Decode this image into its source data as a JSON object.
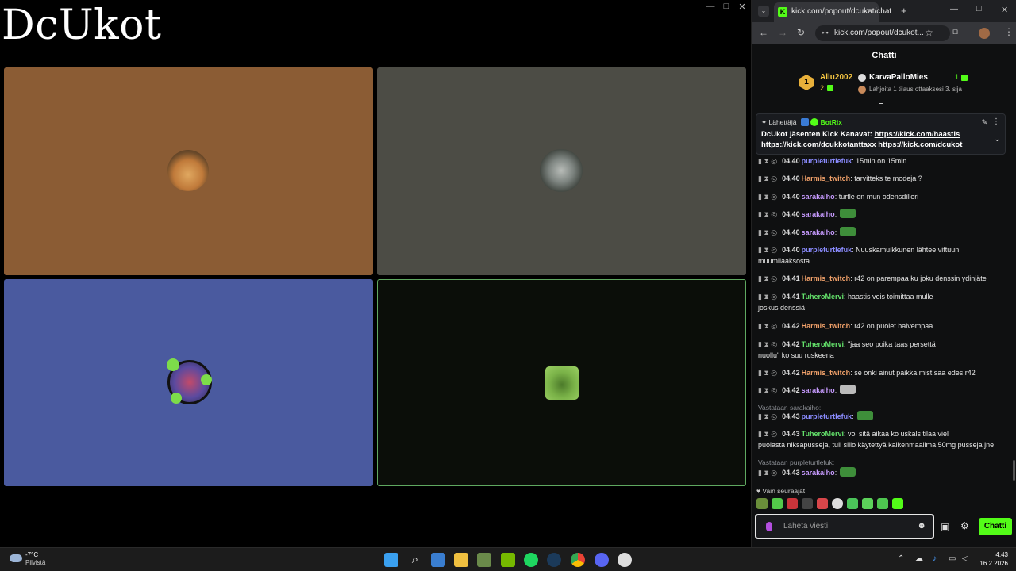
{
  "stream": {
    "title": "DcUkot",
    "window_controls": [
      "—",
      "□",
      "✕"
    ],
    "tiles": [
      {
        "color": "#8b5c34"
      },
      {
        "color": "#4c4c45"
      },
      {
        "color": "#4a5a9f"
      },
      {
        "color": "#0b0e09",
        "border": "#5fa860"
      }
    ]
  },
  "browser": {
    "tab_title": "kick.com/popout/dcukot/chat",
    "tab_close": "×",
    "new_tab": "+",
    "window_controls": [
      "—",
      "□",
      "✕"
    ],
    "url": "kick.com/popout/dcukot...",
    "nav": {
      "back": "←",
      "forward": "→",
      "reload": "↻"
    },
    "toolbar_icons": [
      "star-icon",
      "extensions-icon",
      "profile-icon",
      "menu-icon"
    ]
  },
  "chat": {
    "header": "Chatti",
    "podium": {
      "rank": "1",
      "first_name": "Allu2002",
      "first_count": "2",
      "second_name": "KarvaPalloMies",
      "second_count": "1",
      "hint": "Lahjoita 1 tilaus ottaaksesi 3. sija"
    },
    "pinned": {
      "prefix": "Lähettäjä",
      "bot": "BotRix",
      "text": "DcUkot jäsenten Kick Kanavat:",
      "link1": "https://kick.com/haastis",
      "link2": "https://kick.com/dcukkotanttaxx",
      "link3": "https://kick.com/dcukot"
    },
    "messages": [
      {
        "time": "04.40",
        "user": "purpleturtlefuk",
        "color": "#8b8cff",
        "text": ": 15min on 15min"
      },
      {
        "time": "04.40",
        "user": "Harmis_twitch",
        "color": "#f1a16a",
        "text": ": tarvitteks te modeja ?"
      },
      {
        "time": "04.40",
        "user": "sarakaiho",
        "color": "#c79bff",
        "text": ": turtle on mun odensdilleri"
      },
      {
        "time": "04.40",
        "user": "sarakaiho",
        "color": "#c79bff",
        "text": ":"
      },
      {
        "time": "04.40",
        "user": "sarakaiho",
        "color": "#c79bff",
        "text": ":"
      },
      {
        "time": "04.40",
        "user": "purpleturtlefuk",
        "color": "#8b8cff",
        "text": ": Nuuskamuikkunen lähtee vittuun",
        "text2": "muumilaaksosta"
      },
      {
        "time": "04.41",
        "user": "Harmis_twitch",
        "color": "#f1a16a",
        "text": ": r42 on parempaa ku joku denssin ydinjäte"
      },
      {
        "time": "04.41",
        "user": "TuheroMervi",
        "color": "#63e06a",
        "text": ": haastis vois toimittaa mulle",
        "text2": "joskus denssiä"
      },
      {
        "time": "04.42",
        "user": "Harmis_twitch",
        "color": "#f1a16a",
        "text": ": r42 on puolet halvempaa"
      },
      {
        "time": "04.42",
        "user": "TuheroMervi",
        "color": "#63e06a",
        "text": ": \"jaa seo poika taas persettä",
        "text2": "nuollu\" ko suu ruskeena"
      },
      {
        "time": "04.42",
        "user": "Harmis_twitch",
        "color": "#f1a16a",
        "text": ": se onki ainut paikka mist saa edes r42"
      },
      {
        "time": "04.42",
        "user": "sarakaiho",
        "color": "#c79bff",
        "text": ":"
      },
      {
        "time": "04.43",
        "user": "purpleturtlefuk",
        "color": "#8b8cff",
        "text": ":"
      },
      {
        "time": "04.43",
        "user": "TuheroMervi",
        "color": "#63e06a",
        "text": ": voi sitä aikaa ko uskals tilaa viel",
        "text2": "puolasta niksapusseja, tuli sillo käytettyä kaikenmaailma 50mg pusseja jne"
      },
      {
        "time": "04.43",
        "user": "sarakaiho",
        "color": "#c79bff",
        "text": ":"
      }
    ],
    "replies": [
      "Vastataan sarakaiho:",
      "Vastataan purpleturtlefuk:"
    ],
    "followers_only": "Vain seuraajat",
    "input_placeholder": "Lähetä viesti",
    "send_label": "Chatti"
  },
  "taskbar": {
    "temp": "-7°C",
    "weather": "Pilvistä",
    "time": "4.43",
    "date": "16.2.2026"
  }
}
